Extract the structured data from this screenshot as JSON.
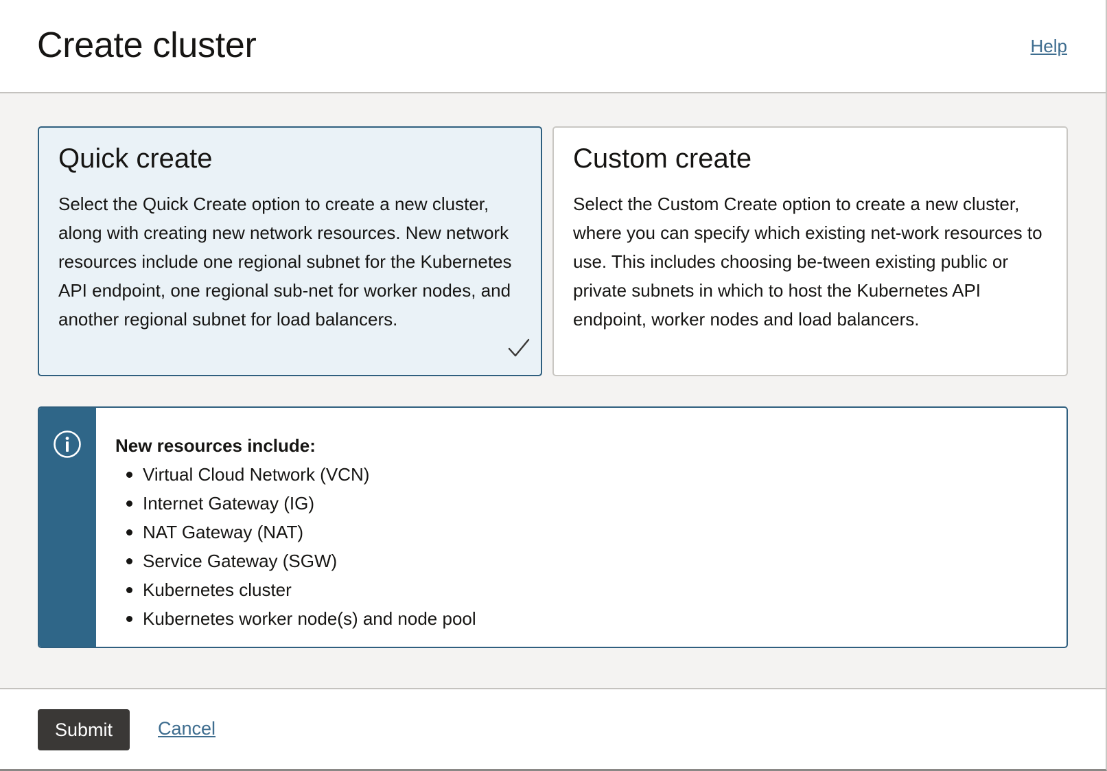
{
  "header": {
    "title": "Create cluster",
    "help_label": "Help"
  },
  "options": {
    "quick": {
      "title": "Quick create",
      "description": "Select the Quick Create option to create a new cluster, along with creating new network resources. New network resources include one regional subnet for the Kubernetes API endpoint, one regional sub-net for worker nodes, and another regional subnet for load balancers.",
      "selected": true
    },
    "custom": {
      "title": "Custom create",
      "description": "Select the Custom Create option to create a new cluster, where you can specify which existing net-work resources to use. This includes choosing be-tween existing public or private subnets in which to host the Kubernetes API endpoint, worker nodes and load balancers.",
      "selected": false
    }
  },
  "info": {
    "icon": "info-icon",
    "heading": "New resources include:",
    "items": [
      "Virtual Cloud Network (VCN)",
      "Internet Gateway (IG)",
      "NAT Gateway (NAT)",
      "Service Gateway (SGW)",
      "Kubernetes cluster",
      "Kubernetes worker node(s) and node pool"
    ]
  },
  "footer": {
    "submit_label": "Submit",
    "cancel_label": "Cancel"
  },
  "colors": {
    "accent": "#2f5f7f",
    "info_strip": "#2f6688",
    "link": "#3e6d8f",
    "selected_bg": "#eaf2f7",
    "button_bg": "#3a3836"
  }
}
